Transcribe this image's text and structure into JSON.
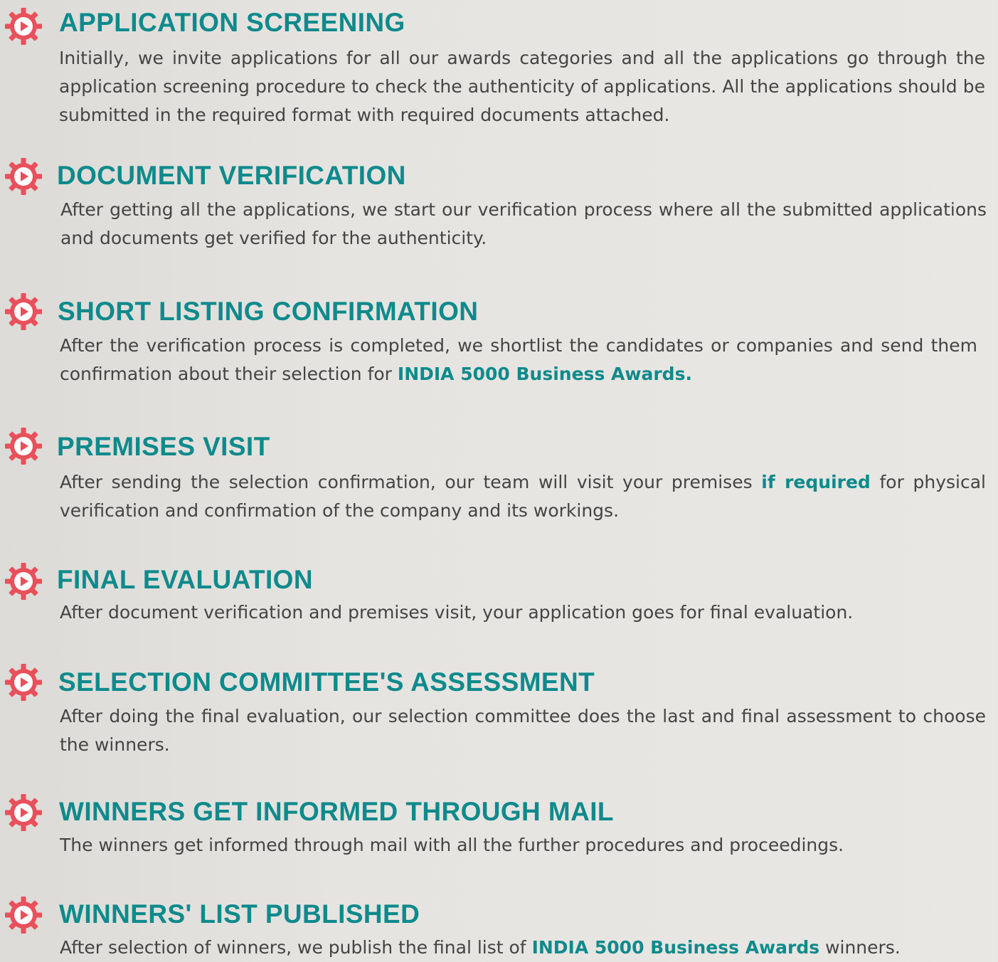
{
  "steps": [
    {
      "title": "APPLICATION SCREENING",
      "text": "Initially, we invite applications for all our awards categories and all the applications go through the application screening procedure to check the authenticity of applications. All the applications should be submitted in the required format with required documents attached."
    },
    {
      "title": "DOCUMENT VERIFICATION",
      "text": "After getting all the applications, we start our verification process where all the submitted applications and documents get verified for the authenticity."
    },
    {
      "title": "SHORT LISTING CONFIRMATION",
      "text_before": "After the verification process is completed, we shortlist the candidates or companies and send them confirmation about their selection for ",
      "highlight": "INDIA 5000 Business Awards."
    },
    {
      "title": "PREMISES VISIT",
      "text_before": "After sending the selection confirmation, our team will visit your premises ",
      "highlight": "if required",
      "text_after": " for physical verification and confirmation of the company and its workings."
    },
    {
      "title": "FINAL EVALUATION",
      "text": "After document verification and premises visit, your application goes for final evaluation."
    },
    {
      "title": "SELECTION COMMITTEE'S ASSESSMENT",
      "text": "After doing the final evaluation, our selection committee does the last and final assessment to choose the winners."
    },
    {
      "title": "WINNERS GET INFORMED THROUGH MAIL",
      "text": "The winners get informed through mail with all the further procedures and proceedings."
    },
    {
      "title": "WINNERS' LIST PUBLISHED",
      "text_before": "After selection of winners, we publish the final list of ",
      "highlight": "INDIA 5000 Business Awards",
      "text_after": " winners."
    }
  ],
  "colors": {
    "title": "#0e8a8c",
    "body_text": "#444444",
    "icon": "#e8505b"
  },
  "icon_name": "gear-play-icon"
}
